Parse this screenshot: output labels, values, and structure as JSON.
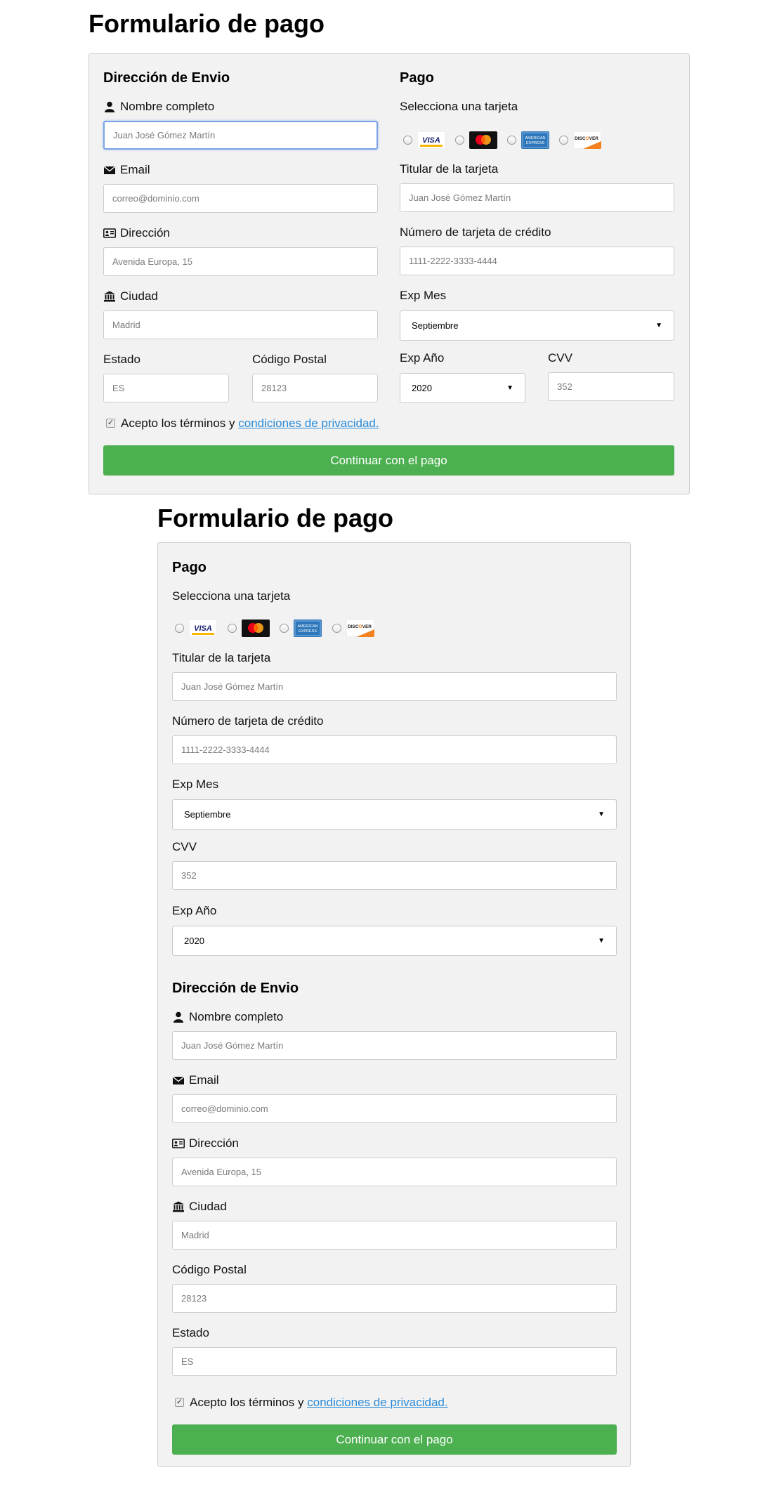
{
  "page_title": "Formulario de pago",
  "form": {
    "shipping": {
      "title": "Dirección de Envio",
      "name_label": "Nombre completo",
      "name_placeholder": "Juan José Gómez Martín",
      "email_label": "Email",
      "email_placeholder": "correo@dominio.com",
      "address_label": "Dirección",
      "address_placeholder": "Avenida Europa, 15",
      "city_label": "Ciudad",
      "city_placeholder": "Madrid",
      "state_label": "Estado",
      "state_placeholder": "ES",
      "zip_label": "Código Postal",
      "zip_placeholder": "28123"
    },
    "payment": {
      "title": "Pago",
      "cards_label": "Selecciona una tarjeta",
      "cards": [
        {
          "name": "VISA",
          "icon": "visa-card-icon"
        },
        {
          "name": "MasterCard",
          "icon": "mastercard-icon"
        },
        {
          "name": "AMERICAN EXPRESS",
          "icon": "amex-card-icon"
        },
        {
          "name": "DISCOVER",
          "icon": "discover-card-icon"
        }
      ],
      "holder_label": "Titular de la tarjeta",
      "holder_placeholder": "Juan José Gómez Martín",
      "number_label": "Número de tarjeta de crédito",
      "number_placeholder": "1111-2222-3333-4444",
      "exp_month_label": "Exp Mes",
      "exp_month_value": "Septiembre",
      "exp_year_label": "Exp Año",
      "exp_year_value": "2020",
      "cvv_label": "CVV",
      "cvv_placeholder": "352"
    },
    "terms_text": "Acepto los términos y ",
    "terms_link": "condiciones de privacidad.",
    "submit_label": "Continuar con el pago"
  },
  "colors": {
    "card_bg": "#f2f2f2",
    "button": "#4caf50",
    "link": "#2a8bd8"
  }
}
